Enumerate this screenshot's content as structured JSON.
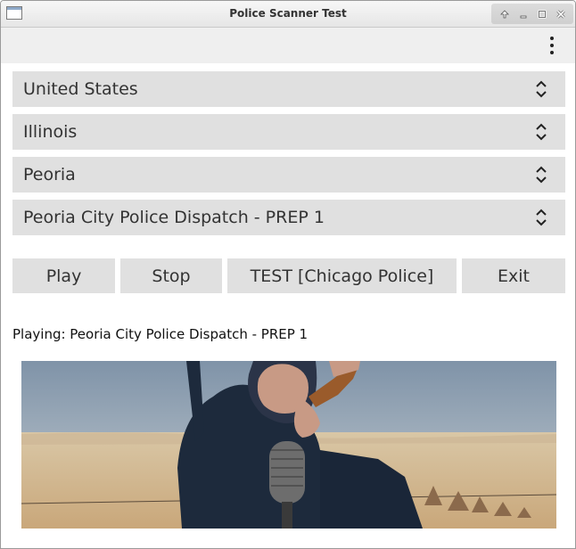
{
  "window": {
    "title": "Police Scanner Test"
  },
  "selectors": {
    "country": "United States",
    "state": "Illinois",
    "city": "Peoria",
    "feed": "Peoria City Police Dispatch - PREP 1"
  },
  "buttons": {
    "play": "Play",
    "stop": "Stop",
    "test": "TEST [Chicago Police]",
    "exit": "Exit"
  },
  "status": {
    "text": "Playing: Peoria City Police Dispatch - PREP 1"
  },
  "icons": {
    "menu": "more-vert-icon",
    "combo_arrows": "chevron-up-down-icon"
  },
  "colors": {
    "toolbar_bg": "#efefef",
    "control_bg": "#e0e0e0"
  }
}
